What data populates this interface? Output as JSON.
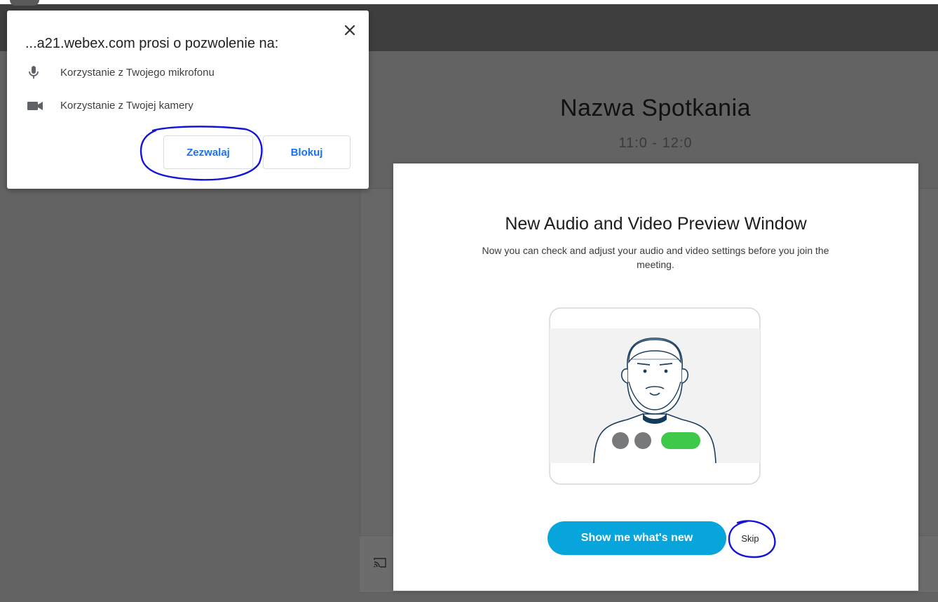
{
  "meeting": {
    "title": "Nazwa Spotkania",
    "time": "11:0 - 12:0"
  },
  "permission_popup": {
    "title": "...a21.webex.com prosi o pozwolenie na:",
    "items": [
      {
        "icon": "microphone-icon",
        "label": "Korzystanie z Twojego mikrofonu"
      },
      {
        "icon": "camera-icon",
        "label": "Korzystanie z Twojej kamery"
      }
    ],
    "allow_label": "Zezwalaj",
    "block_label": "Blokuj",
    "close_icon": "close-icon"
  },
  "preview_dialog": {
    "heading": "New Audio and Video Preview Window",
    "description": "Now you can check and adjust your audio and video settings before you join the meeting.",
    "primary_button": "Show me what's new",
    "skip_button": "Skip"
  },
  "colors": {
    "primary_button": "#08a5dd",
    "link_blue": "#1a73e8",
    "toggle_green": "#3fc94b",
    "annotation_ink": "#1414d6"
  }
}
